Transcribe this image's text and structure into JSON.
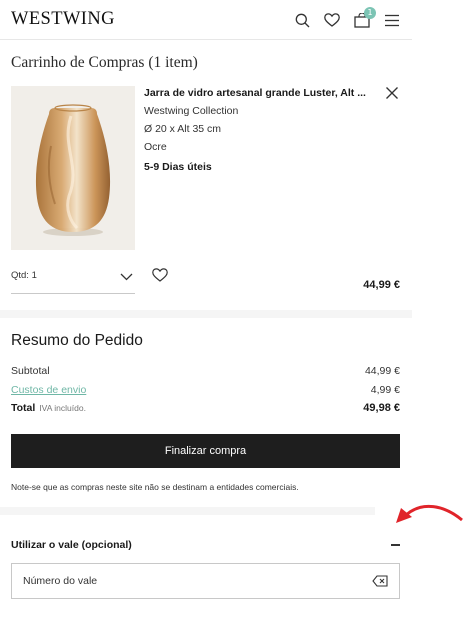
{
  "header": {
    "logo": "WESTWING",
    "cart_badge": "1",
    "icons": [
      "search-icon",
      "heart-icon",
      "cart-icon",
      "menu-icon"
    ]
  },
  "cart": {
    "title": "Carrinho de Compras (1 item)",
    "item": {
      "name": "Jarra de vidro artesanal grande Luster, Alt ...",
      "brand": "Westwing Collection",
      "dimensions": "Ø 20 x Alt 35 cm",
      "color": "Ocre",
      "delivery": "5-9 Dias úteis",
      "quantity_label": "Qtd: 1",
      "price": "44,99 €"
    }
  },
  "summary": {
    "title": "Resumo do Pedido",
    "subtotal_label": "Subtotal",
    "subtotal_value": "44,99 €",
    "shipping_label": "Custos de envio",
    "shipping_value": "4,99 €",
    "total_label": "Total",
    "total_note": "IVA incluído.",
    "total_value": "49,98 €",
    "checkout_label": "Finalizar compra",
    "notice": "Note-se que as compras neste site não se destinam a entidades comerciais."
  },
  "voucher": {
    "title": "Utilizar o vale (opcional)",
    "placeholder": "Número do vale"
  },
  "colors": {
    "accent": "#6fb7a6",
    "button": "#1e1e1e",
    "arrow": "#e0242a"
  }
}
